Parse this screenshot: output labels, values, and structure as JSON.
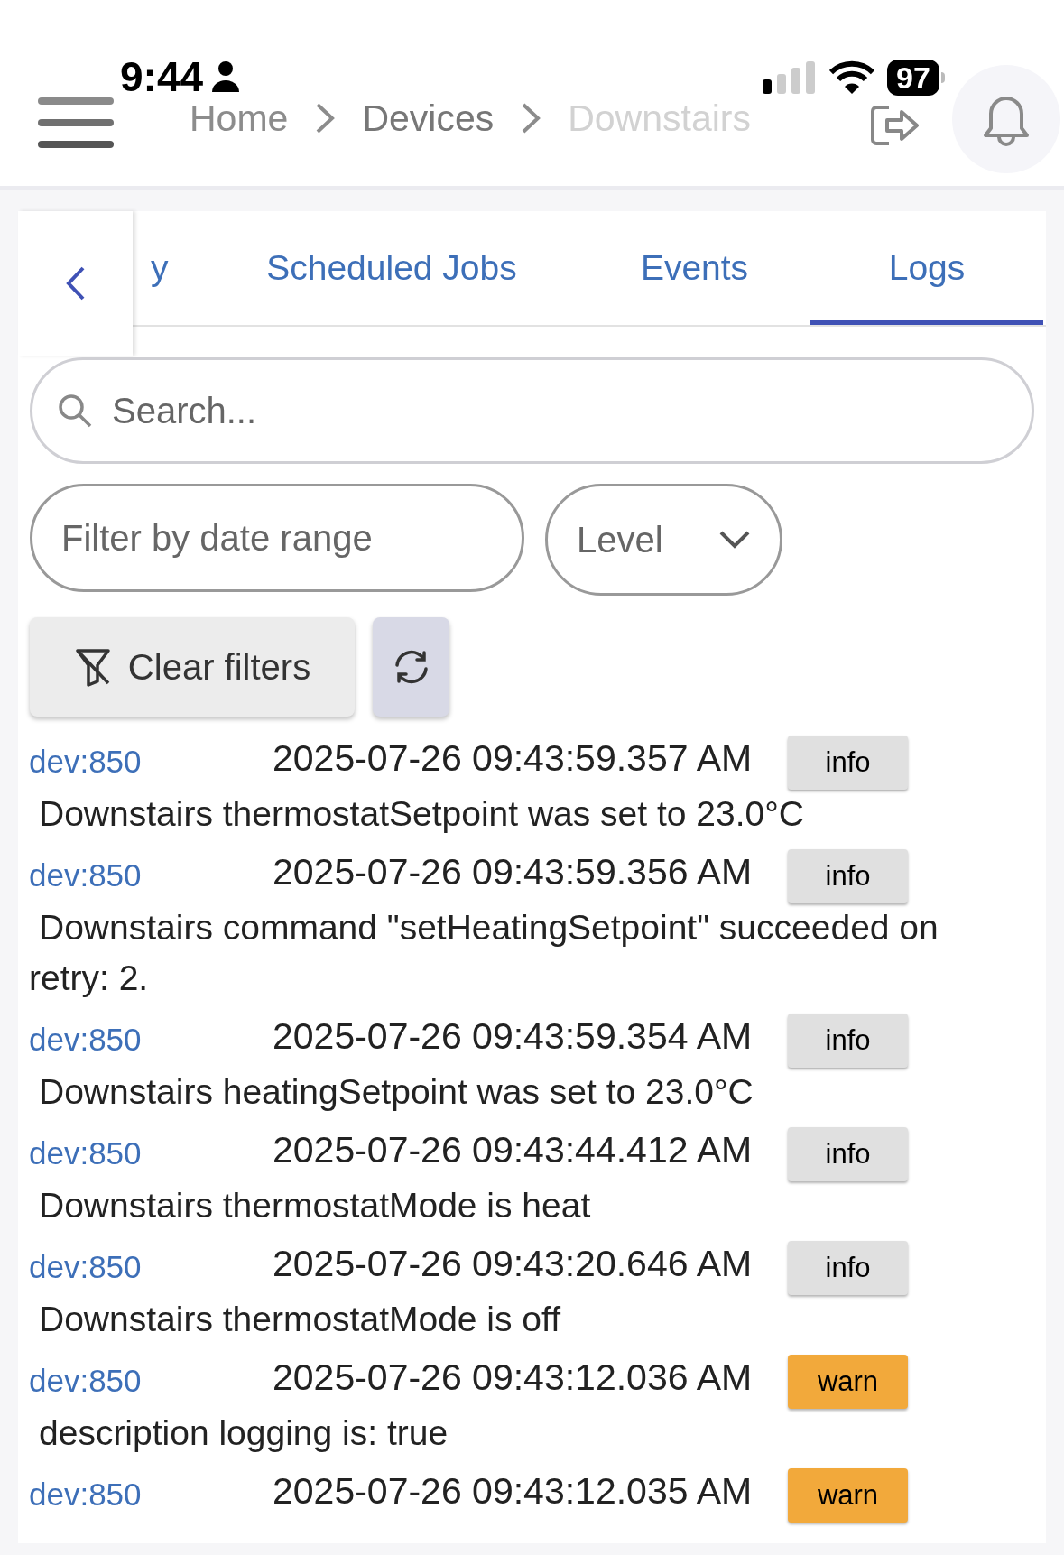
{
  "status_bar": {
    "time": "9:44",
    "battery": "97"
  },
  "breadcrumb": [
    {
      "label": "Home",
      "current": false
    },
    {
      "label": "Devices",
      "current": false
    },
    {
      "label": "Downstairs",
      "current": true
    }
  ],
  "tabs": [
    {
      "label": "y",
      "selected": false
    },
    {
      "label": "Scheduled Jobs",
      "selected": false
    },
    {
      "label": "Events",
      "selected": false
    },
    {
      "label": "Logs",
      "selected": true
    }
  ],
  "search": {
    "placeholder": "Search..."
  },
  "date_filter": {
    "placeholder": "Filter by date range"
  },
  "level_select": {
    "label": "Level"
  },
  "clear_button": {
    "label": "Clear filters"
  },
  "logs": [
    {
      "source": "dev:850",
      "timestamp": "2025-07-26 09:43:59.357 AM",
      "level": "info",
      "color": "#e0e0e0",
      "message": "Downstairs thermostatSetpoint was set to 23.0°C"
    },
    {
      "source": "dev:850",
      "timestamp": "2025-07-26 09:43:59.356 AM",
      "level": "info",
      "color": "#e0e0e0",
      "message": "Downstairs command \"setHeatingSetpoint\" succeeded on retry: 2."
    },
    {
      "source": "dev:850",
      "timestamp": "2025-07-26 09:43:59.354 AM",
      "level": "info",
      "color": "#e0e0e0",
      "message": "Downstairs heatingSetpoint was set to 23.0°C"
    },
    {
      "source": "dev:850",
      "timestamp": "2025-07-26 09:43:44.412 AM",
      "level": "info",
      "color": "#e0e0e0",
      "message": "Downstairs thermostatMode is heat"
    },
    {
      "source": "dev:850",
      "timestamp": "2025-07-26 09:43:20.646 AM",
      "level": "info",
      "color": "#e0e0e0",
      "message": "Downstairs thermostatMode is off"
    },
    {
      "source": "dev:850",
      "timestamp": "2025-07-26 09:43:12.036 AM",
      "level": "warn",
      "color": "#f2a93b",
      "message": "description logging is: true"
    },
    {
      "source": "dev:850",
      "timestamp": "2025-07-26 09:43:12.035 AM",
      "level": "warn",
      "color": "#f2a93b"
    }
  ]
}
